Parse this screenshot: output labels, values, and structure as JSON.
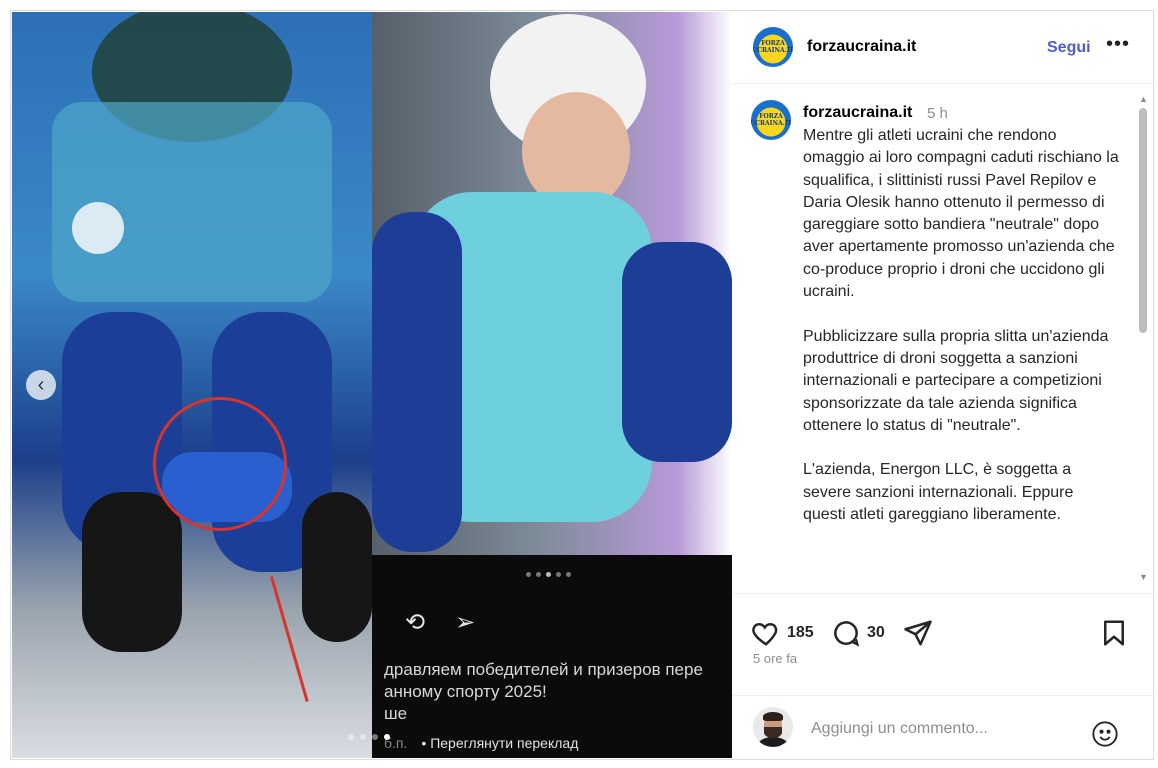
{
  "media": {
    "russian_line1": "дравляем победителей и призеров пере",
    "russian_line2": "анному спорту 2025!",
    "russian_line3": "ше",
    "russian_link": "Переглянути переклад",
    "russian_prefix": "б.п."
  },
  "header": {
    "avatar_text": "FORZA\nUCRAINA.IT",
    "username": "forzaucraina.it",
    "follow_label": "Segui",
    "more_label": "•••"
  },
  "caption": {
    "username": "forzaucraina.it",
    "time": "5 h",
    "text": "Mentre gli atleti ucraini che rendono omaggio ai loro compagni caduti rischiano la squalifica, i slittinisti russi Pavel Repilov e Daria Olesik hanno ottenuto il permesso di gareggiare sotto bandiera \"neutrale\" dopo aver apertamente promosso un'azienda che co-produce proprio i droni che uccidono gli ucraini.\n\nPubblicizzare sulla propria slitta un'azienda produttrice di droni soggetta a sanzioni internazionali e partecipare a competizioni sponsorizzate da tale azienda significa ottenere lo status di \"neutrale\".\n\nL'azienda, Energon LLC, è soggetta a severe sanzioni internazionali. Eppure questi atleti gareggiano liberamente."
  },
  "actions": {
    "likes": "185",
    "comments": "30",
    "time_ago": "5 ore fa"
  },
  "comment": {
    "placeholder": "Aggiungi un commento..."
  }
}
